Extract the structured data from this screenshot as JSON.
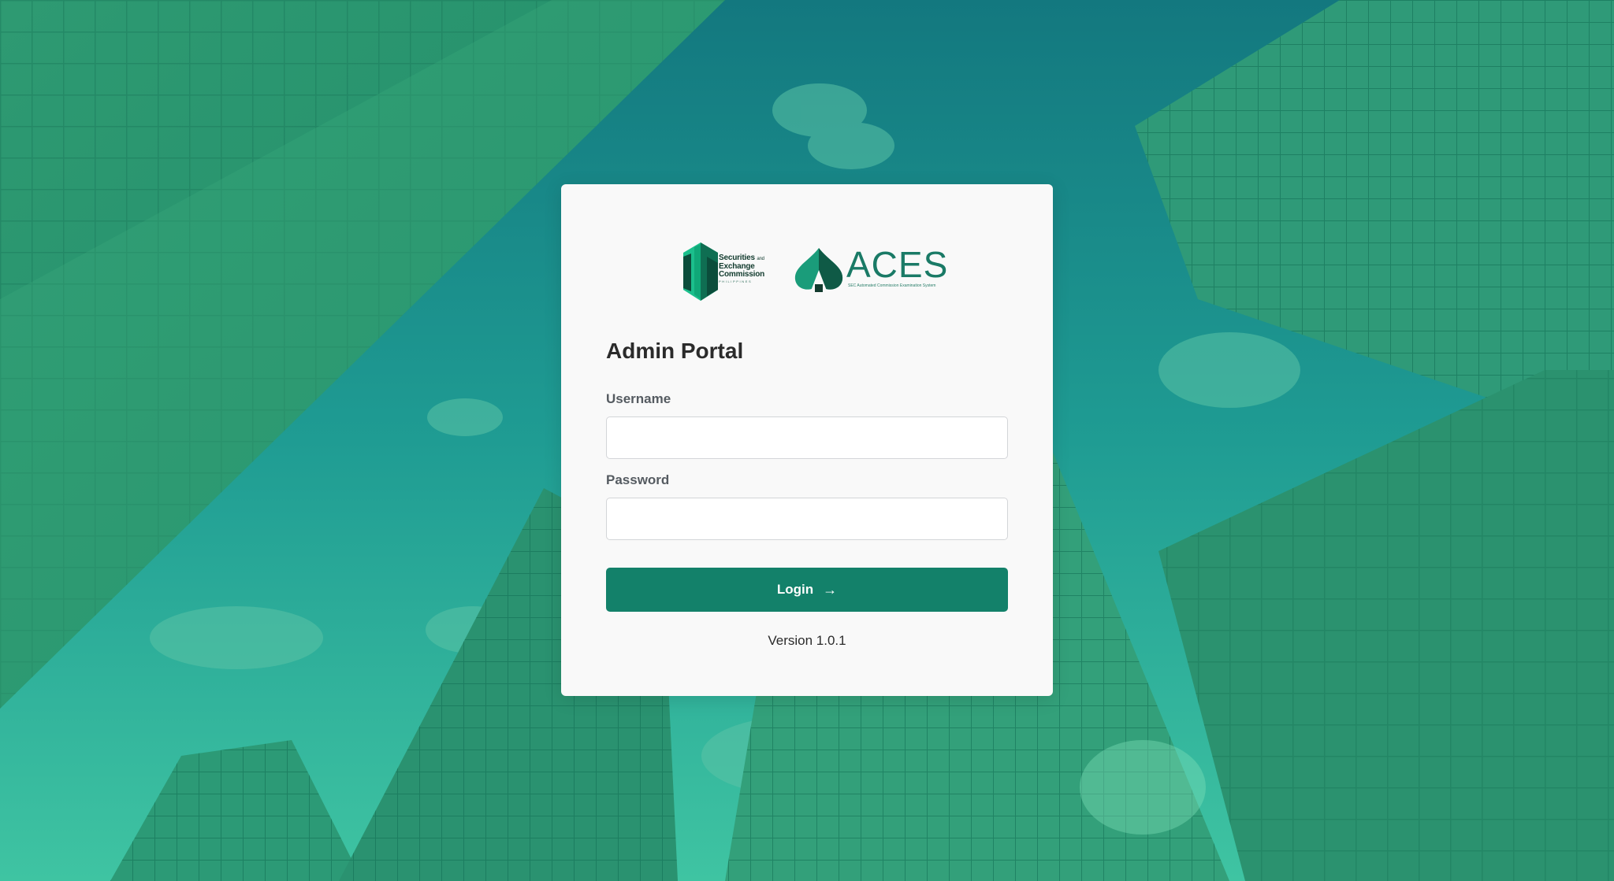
{
  "login": {
    "title": "Admin Portal",
    "username_label": "Username",
    "username_value": "",
    "password_label": "Password",
    "password_value": "",
    "login_label": "Login",
    "login_icon": "arrow-right-icon",
    "version": "Version 1.0.1"
  },
  "branding": {
    "sec_line1": "Securities",
    "sec_and": "and",
    "sec_line2": "Exchange",
    "sec_line3": "Commission",
    "sec_sub": "PHILIPPINES",
    "aces_word": "ACES",
    "aces_tagline": "SEC Automated Commission Examination System"
  },
  "colors": {
    "primary": "#13816a",
    "overlay_green": "#1f9a86",
    "card_bg": "#f9f9f9",
    "logo_dark": "#123b2e",
    "logo_green": "#1a7a66"
  }
}
